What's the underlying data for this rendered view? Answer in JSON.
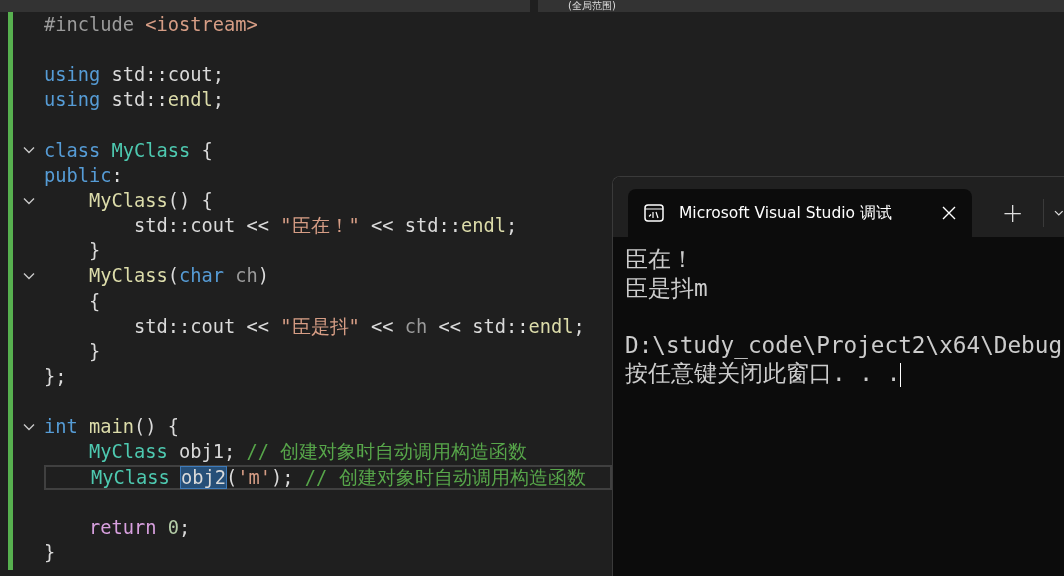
{
  "top_bar": {
    "scope": "(全局范围)"
  },
  "editor": {
    "lines": [
      {
        "tokens": [
          {
            "text": "#include ",
            "kind": "macro"
          },
          {
            "text": "<iostream>",
            "kind": "string"
          }
        ]
      },
      {
        "gap_before": true,
        "tokens": [
          {
            "text": "using",
            "kind": "keyword"
          },
          {
            "text": " std::cout;",
            "kind": "plain"
          }
        ]
      },
      {
        "tokens": [
          {
            "text": "using",
            "kind": "keyword"
          },
          {
            "text": " std::",
            "kind": "plain"
          },
          {
            "text": "endl",
            "kind": "func"
          },
          {
            "text": ";",
            "kind": "plain"
          }
        ]
      },
      {
        "gap_before": true,
        "fold": true,
        "tokens": [
          {
            "text": "class",
            "kind": "keyword"
          },
          {
            "text": " MyClass",
            "kind": "type"
          },
          {
            "text": " {",
            "kind": "plain"
          }
        ]
      },
      {
        "tokens": [
          {
            "text": "public",
            "kind": "keyword"
          },
          {
            "text": ":",
            "kind": "plain"
          }
        ]
      },
      {
        "fold": true,
        "tokens": [
          {
            "text": "    MyClass",
            "kind": "func"
          },
          {
            "text": "() {",
            "kind": "plain"
          }
        ]
      },
      {
        "tokens": [
          {
            "text": "        std::cout << ",
            "kind": "plain"
          },
          {
            "text": "\"臣在！\"",
            "kind": "string"
          },
          {
            "text": " << std::",
            "kind": "plain"
          },
          {
            "text": "endl",
            "kind": "func"
          },
          {
            "text": ";",
            "kind": "plain"
          }
        ]
      },
      {
        "tokens": [
          {
            "text": "    }",
            "kind": "plain"
          }
        ]
      },
      {
        "fold": true,
        "tokens": [
          {
            "text": "    MyClass",
            "kind": "func"
          },
          {
            "text": "(",
            "kind": "plain"
          },
          {
            "text": "char",
            "kind": "keyword"
          },
          {
            "text": " ch",
            "kind": "param"
          },
          {
            "text": ")",
            "kind": "plain"
          }
        ]
      },
      {
        "tokens": [
          {
            "text": "    {",
            "kind": "plain"
          }
        ]
      },
      {
        "tokens": [
          {
            "text": "        std::cout << ",
            "kind": "plain"
          },
          {
            "text": "\"臣是抖\"",
            "kind": "string"
          },
          {
            "text": " << ",
            "kind": "plain"
          },
          {
            "text": "ch",
            "kind": "param"
          },
          {
            "text": " << std::",
            "kind": "plain"
          },
          {
            "text": "endl",
            "kind": "func"
          },
          {
            "text": ";",
            "kind": "plain"
          }
        ]
      },
      {
        "tokens": [
          {
            "text": "    }",
            "kind": "plain"
          }
        ]
      },
      {
        "tokens": [
          {
            "text": "};",
            "kind": "plain"
          }
        ]
      },
      {
        "gap_before": true,
        "fold": true,
        "tokens": [
          {
            "text": "int",
            "kind": "keyword"
          },
          {
            "text": " main",
            "kind": "func"
          },
          {
            "text": "() {",
            "kind": "plain"
          }
        ]
      },
      {
        "tokens": [
          {
            "text": "    MyClass",
            "kind": "type"
          },
          {
            "text": " obj1; ",
            "kind": "plain"
          },
          {
            "text": "// 创建对象时自动调用构造函数",
            "kind": "comment"
          }
        ]
      },
      {
        "current": true,
        "tokens": [
          {
            "text": "    MyClass ",
            "kind": "type"
          },
          {
            "text": "obj2",
            "kind": "plain",
            "selected": true
          },
          {
            "text": "(",
            "kind": "plain"
          },
          {
            "text": "'m'",
            "kind": "string"
          },
          {
            "text": "); ",
            "kind": "plain"
          },
          {
            "text": "// 创建对象时自动调用构造函数",
            "kind": "comment"
          }
        ]
      },
      {
        "gap_before": true,
        "tokens": [
          {
            "text": "    return",
            "kind": "control"
          },
          {
            "text": " 0",
            "kind": "number"
          },
          {
            "text": ";",
            "kind": "plain"
          }
        ]
      },
      {
        "tokens": [
          {
            "text": "}",
            "kind": "plain"
          }
        ]
      }
    ]
  },
  "terminal": {
    "tab": {
      "title": "Microsoft Visual Studio 调试",
      "selected": true
    },
    "new_tab": "+",
    "output": [
      {
        "text": "臣在！"
      },
      {
        "text": "臣是抖m"
      },
      {
        "gap_before": true,
        "text": "D:\\study_code\\Project2\\x64\\Debug"
      },
      {
        "text": "按任意键关闭此窗口. . .",
        "cursor": true
      }
    ]
  }
}
